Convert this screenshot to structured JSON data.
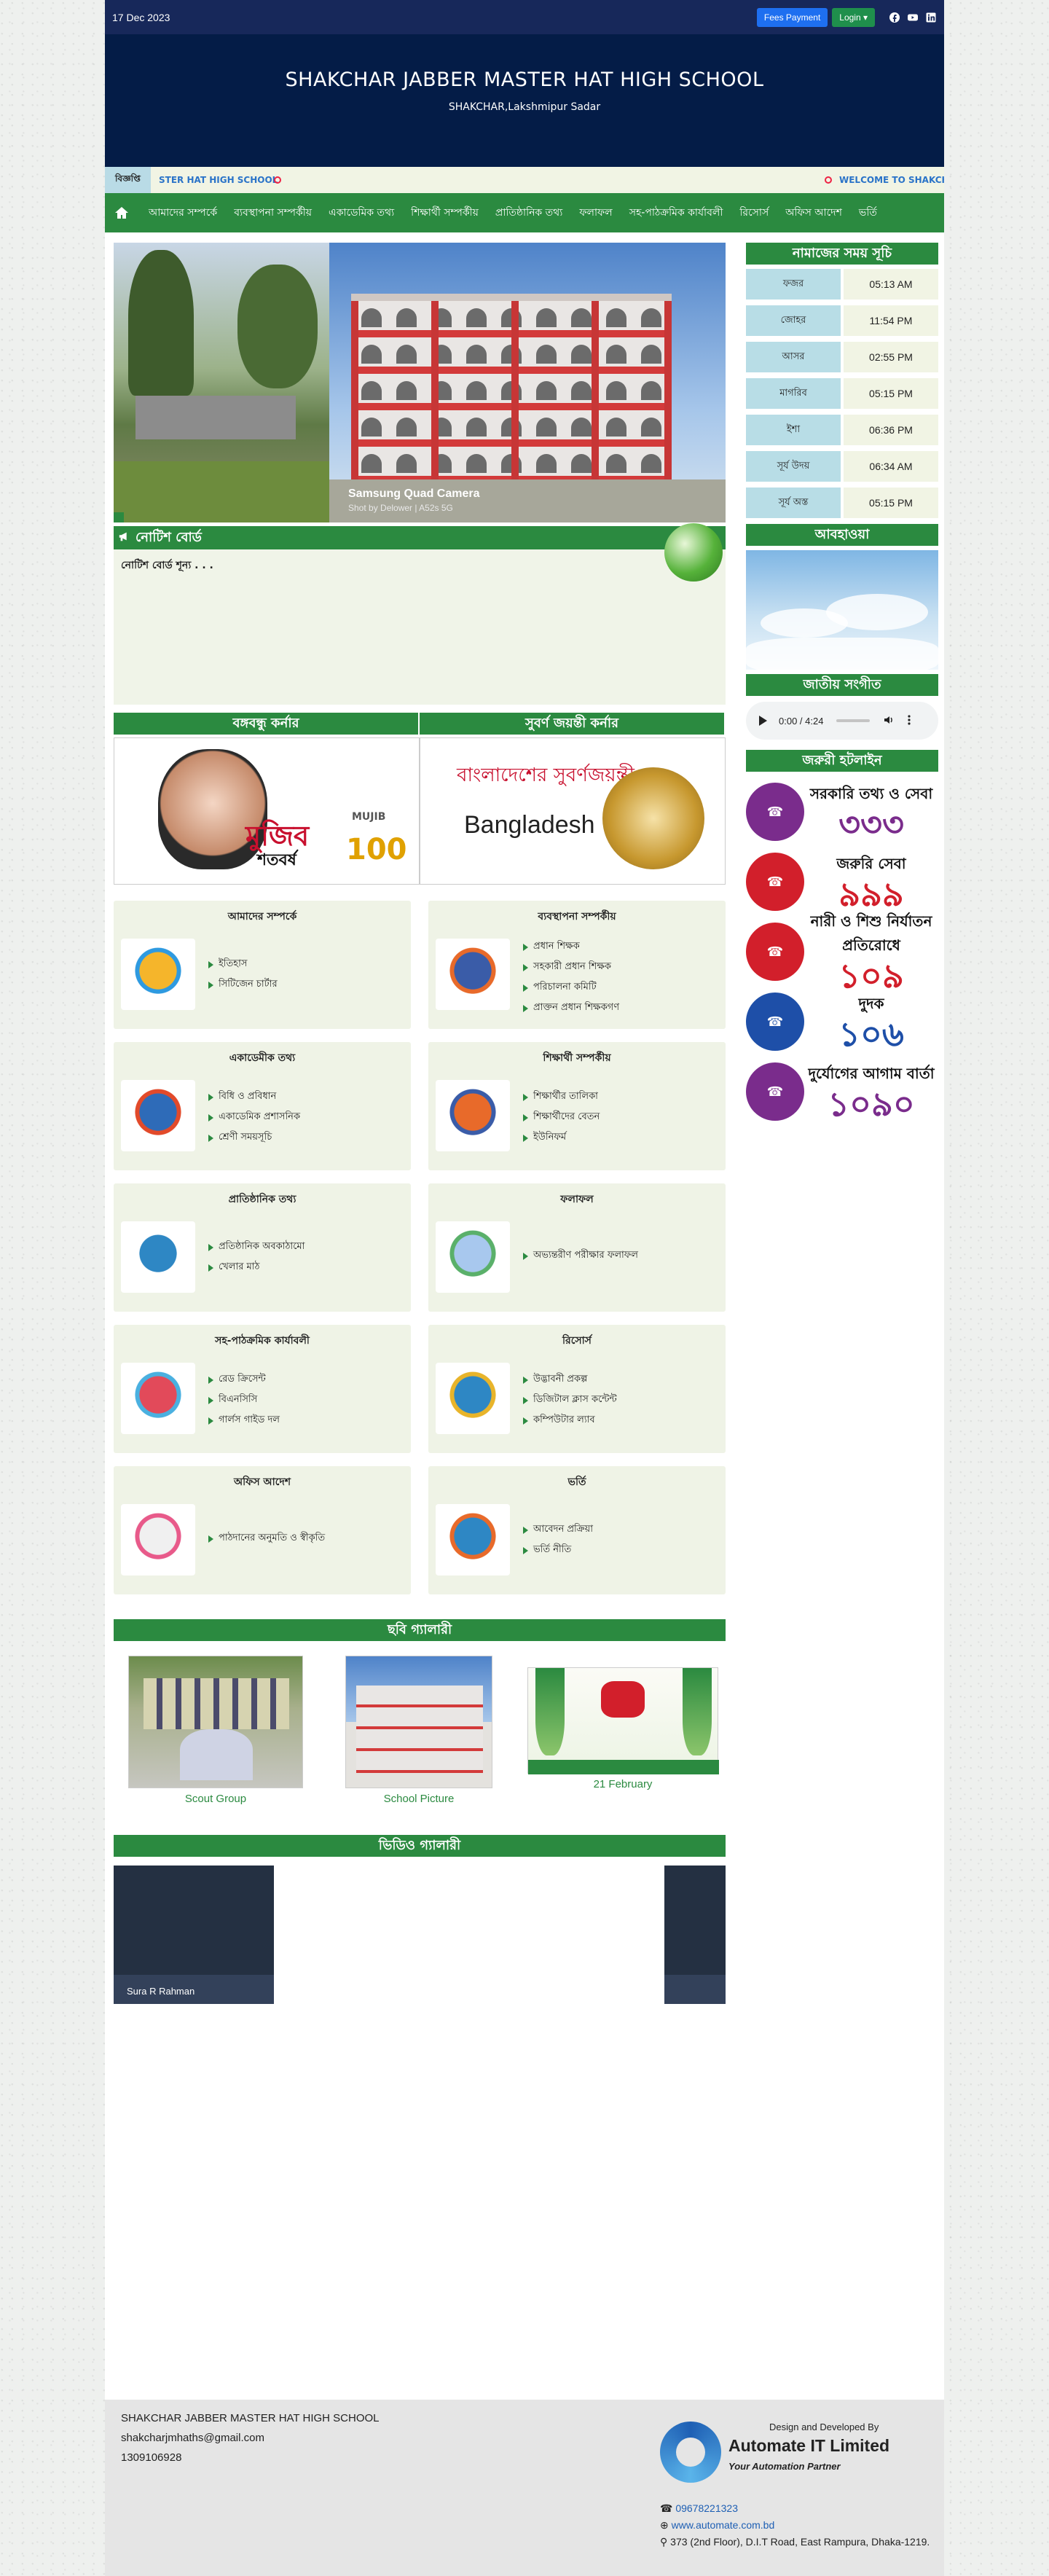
{
  "topbar": {
    "date": "17 Dec 2023",
    "fees_label": "Fees Payment",
    "login_label": "Login ▾",
    "social_icons": [
      "facebook-icon",
      "youtube-icon",
      "linkedin-icon"
    ]
  },
  "header": {
    "school_name": "SHAKCHAR JABBER MASTER HAT HIGH SCHOOL",
    "location": "SHAKCHAR,Lakshmipur Sadar"
  },
  "marquee": {
    "tag": "বিজ্ঞপ্তি",
    "item1": "STER HAT HIGH SCHOOL",
    "item2": "WELCOME TO SHAKCHA"
  },
  "nav": {
    "items": [
      "আমাদের সম্পর্কে",
      "ব্যবস্থাপনা সম্পর্কীয়",
      "একাডেমিক তথ্য",
      "শিক্ষার্থী সম্পর্কীয়",
      "প্রাতিষ্ঠানিক তথ্য",
      "ফলাফল",
      "সহ-পাঠক্রমিক কার্যাবলী",
      "রিসোর্স",
      "অফিস আদেশ",
      "ভর্তি"
    ]
  },
  "slider": {
    "camera": "Samsung Quad Camera",
    "camera_sub": "Shot by Delower | A52s 5G"
  },
  "notice": {
    "title": "নোটিশ বোর্ড",
    "empty": "নোটিশ বোর্ড শূন্য . . ."
  },
  "corners": {
    "left_title": "বঙ্গবন্ধু কর্নার",
    "right_title": "সুবর্ণ জয়ন্তী কর্নার",
    "mujib_text": "মুজিব",
    "mujib_sub": "শতবর্ষ",
    "mujib_label": "MUJIB",
    "mujib_num": "100",
    "bd_text_a": "বাংলাদেশের সুবর্ণজয়ন্তী",
    "bd_text_b": "Bangladesh"
  },
  "cards": [
    {
      "title": "আমাদের সম্পর্কে",
      "items": [
        "ইতিহাস",
        "সিটিজেন চার্টার"
      ]
    },
    {
      "title": "ব্যবস্থাপনা সম্পর্কীয়",
      "items": [
        "প্রধান শিক্ষক",
        "সহকারী প্রধান শিক্ষক",
        "পরিচালনা কমিটি",
        "প্রাক্তন প্রধান শিক্ষকগণ"
      ]
    },
    {
      "title": "একাডেমীক তথ্য",
      "items": [
        "বিধি ও প্রবিধান",
        "একাডেমিক প্রশাসনিক",
        "শ্রেণী সময়সূচি"
      ]
    },
    {
      "title": "শিক্ষার্থী সম্পর্কীয়",
      "items": [
        "শিক্ষার্থীর তালিকা",
        "শিক্ষার্থীদের বেতন",
        "ইউনিফর্ম"
      ]
    },
    {
      "title": "প্রাতিষ্ঠানিক তথ্য",
      "items": [
        "প্রতিষ্ঠানিক অবকাঠামো",
        "খেলার মাঠ"
      ]
    },
    {
      "title": "ফলাফল",
      "items": [
        "অভ্যন্তরীণ পরীক্ষার ফলাফল"
      ]
    },
    {
      "title": "সহ-পাঠক্রমিক কার্যাবলী",
      "items": [
        "রেড ক্রিসেন্ট",
        "বিএনসিসি",
        "গার্লস গাইড দল"
      ]
    },
    {
      "title": "রিসোর্স",
      "items": [
        "উদ্ভাবনী প্রকল্প",
        "ডিজিটাল ক্লাস কন্টেন্ট",
        "কম্পিউটার ল্যাব"
      ]
    },
    {
      "title": "অফিস আদেশ",
      "items": [
        "পাঠদানের অনুমতি ও স্বীকৃতি"
      ]
    },
    {
      "title": "ভর্তি",
      "items": [
        "আবেদন প্রক্রিয়া",
        "ভর্তি নীতি"
      ]
    }
  ],
  "gallery": {
    "title": "ছবি গ্যালারী",
    "items": [
      {
        "label": "Scout Group"
      },
      {
        "label": "School Picture"
      },
      {
        "label": "21 February"
      }
    ]
  },
  "video": {
    "title": "ভিডিও গ্যালারী",
    "caption": "Sura R Rahman"
  },
  "sidebar": {
    "prayer_title": "নামাজের সময় সূচি",
    "prayers": [
      {
        "name": "ফজর",
        "time": "05:13 AM"
      },
      {
        "name": "জোহর",
        "time": "11:54 PM"
      },
      {
        "name": "আসর",
        "time": "02:55 PM"
      },
      {
        "name": "মাগরিব",
        "time": "05:15 PM"
      },
      {
        "name": "ইশা",
        "time": "06:36 PM"
      },
      {
        "name": "সূর্য উদয়",
        "time": "06:34 AM"
      },
      {
        "name": "সূর্য অস্ত",
        "time": "05:15 PM"
      }
    ],
    "weather_title": "আবহাওয়া",
    "anthem_title": "জাতীয় সংগীত",
    "audio_time": "0:00 / 4:24",
    "hotline_title": "জরুরী হটলাইন",
    "hotlines": [
      {
        "label": "সরকারি তথ্য ও সেবা",
        "number": "৩৩৩",
        "color": "#7a2c8c"
      },
      {
        "label": "জরুরি সেবা",
        "number": "৯৯৯",
        "color": "#d21f2b"
      },
      {
        "label": "নারী ও শিশু নির্যাতন প্রতিরোধে",
        "number": "১০৯",
        "color": "#d21f2b"
      },
      {
        "label": "দুদক",
        "number": "১০৬",
        "color": "#1e4fa8"
      },
      {
        "label": "দুর্যোগের আগাম বার্তা",
        "number": "১০৯০",
        "color": "#7a2c8c"
      }
    ]
  },
  "footer": {
    "school": "SHAKCHAR JABBER MASTER HAT HIGH SCHOOL",
    "email": "shakcharjmhaths@gmail.com",
    "phone": "1309106928",
    "designed_by": "Design and Developed By",
    "company": "Automate IT Limited",
    "tagline": "Your Automation Partner",
    "company_phone": "09678221323",
    "company_web": "www.automate.com.bd",
    "company_addr": "373 (2nd Floor), D.I.T Road, East Rampura, Dhaka-1219."
  }
}
